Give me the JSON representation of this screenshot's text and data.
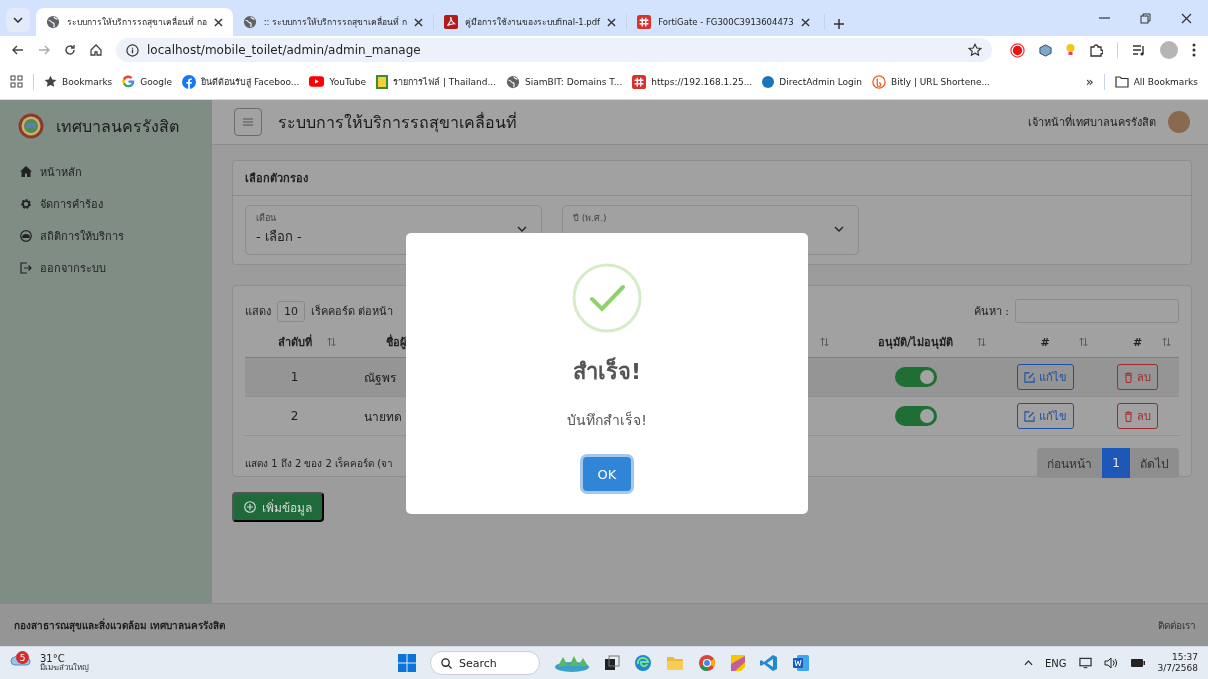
{
  "browser": {
    "tabs": [
      {
        "title": "ระบบการให้บริการรถสุขาเคลื่อนที่ กอ",
        "kind": "web",
        "selected": true
      },
      {
        "title": ":: ระบบการให้บริการรถสุขาเคลื่อนที่ ก",
        "kind": "web",
        "selected": false
      },
      {
        "title": "คู่มือการใช้งานของระบบfinal-1.pdf",
        "kind": "pdf",
        "selected": false
      },
      {
        "title": "FortiGate - FG300C3913604473",
        "kind": "forti",
        "selected": false
      }
    ],
    "address": "localhost/mobile_toilet/admin/admin_manage",
    "bookmarks": [
      {
        "label": "Bookmarks",
        "kind": "star"
      },
      {
        "label": "Google",
        "kind": "google"
      },
      {
        "label": "ยินดีต้อนรับสู่ Faceboo...",
        "kind": "facebook"
      },
      {
        "label": "YouTube",
        "kind": "youtube"
      },
      {
        "label": "รายการไฟล์ | Thailand...",
        "kind": "file"
      },
      {
        "label": "SiamBIT: Domains T...",
        "kind": "web"
      },
      {
        "label": "https://192.168.1.25...",
        "kind": "forti"
      },
      {
        "label": "DirectAdmin Login",
        "kind": "dot"
      },
      {
        "label": "Bitly | URL Shortene...",
        "kind": "bitly"
      }
    ],
    "more": "»",
    "all_bookmarks": "All Bookmarks"
  },
  "app": {
    "brand": "เทศบาลนครรังสิต",
    "menu": [
      {
        "label": "หน้าหลัก",
        "kind": "home"
      },
      {
        "label": "จัดการคำร้อง",
        "kind": "gear"
      },
      {
        "label": "สถิติการให้บริการ",
        "kind": "gauge"
      },
      {
        "label": "ออกจากระบบ",
        "kind": "logout"
      }
    ],
    "title": "ระบบการให้บริการรถสุขาเคลื่อนที่",
    "user": "เจ้าหน้าที่เทศบาลนครรังสิต",
    "filter": {
      "title": "เลือกตัวกรอง",
      "fields": [
        {
          "label": "เดือน",
          "value": "- เลือก -"
        },
        {
          "label": "ปี (พ.ศ.)"
        }
      ]
    },
    "table": {
      "show": "แสดง",
      "page_size": "10",
      "per_page": "เร็คคอร์ด ต่อหน้า",
      "search_label": "ค้นหา :",
      "columns": [
        "ลำดับที่",
        "ชื่อผู้",
        "อนุมัติ/ไม่อนุมัติ",
        "#",
        "#"
      ],
      "rows": [
        {
          "no": "1",
          "name": "ณัฐพร",
          "approved": true,
          "edit": "แก้ไข",
          "delete": "ลบ"
        },
        {
          "no": "2",
          "name": "นายทด",
          "approved": true,
          "edit": "แก้ไข",
          "delete": "ลบ"
        }
      ],
      "info": "แสดง 1 ถึง 2 ของ 2 เร็คคอร์ด (จา",
      "pages": [
        {
          "label": "ก่อนหน้า",
          "selected": false
        },
        {
          "label": "1",
          "selected": true
        },
        {
          "label": "ถัดไป",
          "selected": false
        }
      ]
    },
    "add_button": "เพิ่มข้อมูล",
    "footer": "กองสาธารณสุขและสิ่งแวดล้อม เทศบาลนครรังสิต",
    "contact": "ติดต่อเรา"
  },
  "dialog": {
    "title": "สำเร็จ!",
    "message": "บันทึกสำเร็จ!",
    "button": "OK"
  },
  "taskbar": {
    "badge": "5",
    "temperature": "31°C",
    "weather": "มีเมฆส่วนใหญ่",
    "search": "Search",
    "language": "ENG",
    "time": "15:37",
    "date": "3/7/2568"
  }
}
